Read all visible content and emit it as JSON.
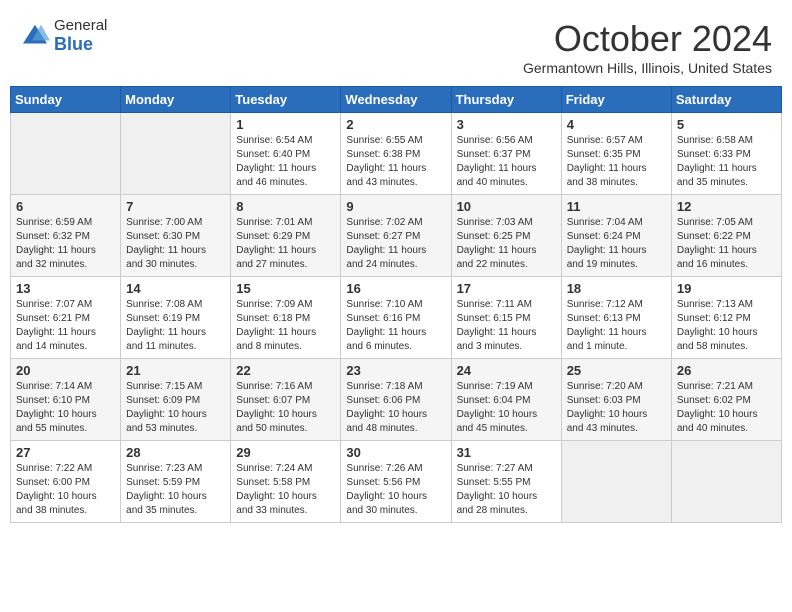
{
  "header": {
    "logo_general": "General",
    "logo_blue": "Blue",
    "month_title": "October 2024",
    "subtitle": "Germantown Hills, Illinois, United States"
  },
  "days_of_week": [
    "Sunday",
    "Monday",
    "Tuesday",
    "Wednesday",
    "Thursday",
    "Friday",
    "Saturday"
  ],
  "weeks": [
    [
      {
        "day": "",
        "sunrise": "",
        "sunset": "",
        "daylight": ""
      },
      {
        "day": "",
        "sunrise": "",
        "sunset": "",
        "daylight": ""
      },
      {
        "day": "1",
        "sunrise": "Sunrise: 6:54 AM",
        "sunset": "Sunset: 6:40 PM",
        "daylight": "Daylight: 11 hours and 46 minutes."
      },
      {
        "day": "2",
        "sunrise": "Sunrise: 6:55 AM",
        "sunset": "Sunset: 6:38 PM",
        "daylight": "Daylight: 11 hours and 43 minutes."
      },
      {
        "day": "3",
        "sunrise": "Sunrise: 6:56 AM",
        "sunset": "Sunset: 6:37 PM",
        "daylight": "Daylight: 11 hours and 40 minutes."
      },
      {
        "day": "4",
        "sunrise": "Sunrise: 6:57 AM",
        "sunset": "Sunset: 6:35 PM",
        "daylight": "Daylight: 11 hours and 38 minutes."
      },
      {
        "day": "5",
        "sunrise": "Sunrise: 6:58 AM",
        "sunset": "Sunset: 6:33 PM",
        "daylight": "Daylight: 11 hours and 35 minutes."
      }
    ],
    [
      {
        "day": "6",
        "sunrise": "Sunrise: 6:59 AM",
        "sunset": "Sunset: 6:32 PM",
        "daylight": "Daylight: 11 hours and 32 minutes."
      },
      {
        "day": "7",
        "sunrise": "Sunrise: 7:00 AM",
        "sunset": "Sunset: 6:30 PM",
        "daylight": "Daylight: 11 hours and 30 minutes."
      },
      {
        "day": "8",
        "sunrise": "Sunrise: 7:01 AM",
        "sunset": "Sunset: 6:29 PM",
        "daylight": "Daylight: 11 hours and 27 minutes."
      },
      {
        "day": "9",
        "sunrise": "Sunrise: 7:02 AM",
        "sunset": "Sunset: 6:27 PM",
        "daylight": "Daylight: 11 hours and 24 minutes."
      },
      {
        "day": "10",
        "sunrise": "Sunrise: 7:03 AM",
        "sunset": "Sunset: 6:25 PM",
        "daylight": "Daylight: 11 hours and 22 minutes."
      },
      {
        "day": "11",
        "sunrise": "Sunrise: 7:04 AM",
        "sunset": "Sunset: 6:24 PM",
        "daylight": "Daylight: 11 hours and 19 minutes."
      },
      {
        "day": "12",
        "sunrise": "Sunrise: 7:05 AM",
        "sunset": "Sunset: 6:22 PM",
        "daylight": "Daylight: 11 hours and 16 minutes."
      }
    ],
    [
      {
        "day": "13",
        "sunrise": "Sunrise: 7:07 AM",
        "sunset": "Sunset: 6:21 PM",
        "daylight": "Daylight: 11 hours and 14 minutes."
      },
      {
        "day": "14",
        "sunrise": "Sunrise: 7:08 AM",
        "sunset": "Sunset: 6:19 PM",
        "daylight": "Daylight: 11 hours and 11 minutes."
      },
      {
        "day": "15",
        "sunrise": "Sunrise: 7:09 AM",
        "sunset": "Sunset: 6:18 PM",
        "daylight": "Daylight: 11 hours and 8 minutes."
      },
      {
        "day": "16",
        "sunrise": "Sunrise: 7:10 AM",
        "sunset": "Sunset: 6:16 PM",
        "daylight": "Daylight: 11 hours and 6 minutes."
      },
      {
        "day": "17",
        "sunrise": "Sunrise: 7:11 AM",
        "sunset": "Sunset: 6:15 PM",
        "daylight": "Daylight: 11 hours and 3 minutes."
      },
      {
        "day": "18",
        "sunrise": "Sunrise: 7:12 AM",
        "sunset": "Sunset: 6:13 PM",
        "daylight": "Daylight: 11 hours and 1 minute."
      },
      {
        "day": "19",
        "sunrise": "Sunrise: 7:13 AM",
        "sunset": "Sunset: 6:12 PM",
        "daylight": "Daylight: 10 hours and 58 minutes."
      }
    ],
    [
      {
        "day": "20",
        "sunrise": "Sunrise: 7:14 AM",
        "sunset": "Sunset: 6:10 PM",
        "daylight": "Daylight: 10 hours and 55 minutes."
      },
      {
        "day": "21",
        "sunrise": "Sunrise: 7:15 AM",
        "sunset": "Sunset: 6:09 PM",
        "daylight": "Daylight: 10 hours and 53 minutes."
      },
      {
        "day": "22",
        "sunrise": "Sunrise: 7:16 AM",
        "sunset": "Sunset: 6:07 PM",
        "daylight": "Daylight: 10 hours and 50 minutes."
      },
      {
        "day": "23",
        "sunrise": "Sunrise: 7:18 AM",
        "sunset": "Sunset: 6:06 PM",
        "daylight": "Daylight: 10 hours and 48 minutes."
      },
      {
        "day": "24",
        "sunrise": "Sunrise: 7:19 AM",
        "sunset": "Sunset: 6:04 PM",
        "daylight": "Daylight: 10 hours and 45 minutes."
      },
      {
        "day": "25",
        "sunrise": "Sunrise: 7:20 AM",
        "sunset": "Sunset: 6:03 PM",
        "daylight": "Daylight: 10 hours and 43 minutes."
      },
      {
        "day": "26",
        "sunrise": "Sunrise: 7:21 AM",
        "sunset": "Sunset: 6:02 PM",
        "daylight": "Daylight: 10 hours and 40 minutes."
      }
    ],
    [
      {
        "day": "27",
        "sunrise": "Sunrise: 7:22 AM",
        "sunset": "Sunset: 6:00 PM",
        "daylight": "Daylight: 10 hours and 38 minutes."
      },
      {
        "day": "28",
        "sunrise": "Sunrise: 7:23 AM",
        "sunset": "Sunset: 5:59 PM",
        "daylight": "Daylight: 10 hours and 35 minutes."
      },
      {
        "day": "29",
        "sunrise": "Sunrise: 7:24 AM",
        "sunset": "Sunset: 5:58 PM",
        "daylight": "Daylight: 10 hours and 33 minutes."
      },
      {
        "day": "30",
        "sunrise": "Sunrise: 7:26 AM",
        "sunset": "Sunset: 5:56 PM",
        "daylight": "Daylight: 10 hours and 30 minutes."
      },
      {
        "day": "31",
        "sunrise": "Sunrise: 7:27 AM",
        "sunset": "Sunset: 5:55 PM",
        "daylight": "Daylight: 10 hours and 28 minutes."
      },
      {
        "day": "",
        "sunrise": "",
        "sunset": "",
        "daylight": ""
      },
      {
        "day": "",
        "sunrise": "",
        "sunset": "",
        "daylight": ""
      }
    ]
  ]
}
